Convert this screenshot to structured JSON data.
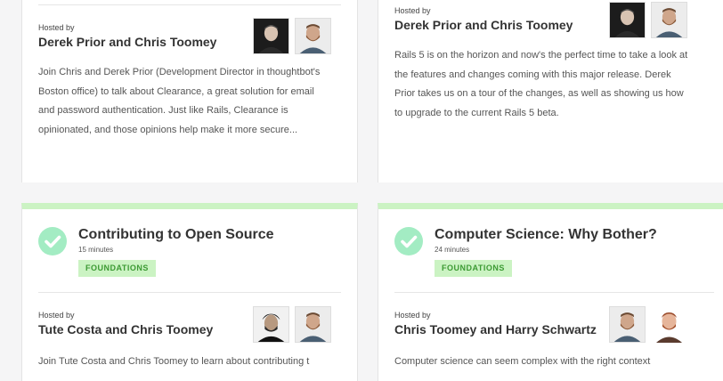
{
  "cards": [
    {
      "hosted_label": "Hosted by",
      "hosts": "Derek Prior and Chris Toomey",
      "description": "Join Chris and Derek Prior (Development Director in thoughtbot's Boston office) to talk about Clearance, a great solution for email and password authentication. Just like Rails, Clearance is opinionated, and those opinions help make it more secure..."
    },
    {
      "hosted_label": "Hosted by",
      "hosts": "Derek Prior and Chris Toomey",
      "description": "Rails 5 is on the horizon and now's the perfect time to take a look at the features and changes coming with this major release. Derek Prior takes us on a tour of the changes, as well as showing us how to upgrade to the current Rails 5 beta."
    },
    {
      "title": "Contributing to Open Source",
      "duration": "15 minutes",
      "badge": "FOUNDATIONS",
      "hosted_label": "Hosted by",
      "hosts": "Tute Costa and Chris Toomey",
      "description": "Join Tute Costa and Chris Toomey to learn about contributing t"
    },
    {
      "title": "Computer Science: Why Bother?",
      "duration": "24 minutes",
      "badge": "FOUNDATIONS",
      "hosted_label": "Hosted by",
      "hosts": "Chris Toomey and Harry Schwartz",
      "description": "Computer science can seem complex with the right context"
    }
  ],
  "icons": {
    "completed": "check-circle-icon",
    "avatar": "host-avatar-icon"
  },
  "colors": {
    "accent_bar": "#cbf3c3",
    "check": "#a3ecc3",
    "badge_text": "#3c9a33"
  }
}
